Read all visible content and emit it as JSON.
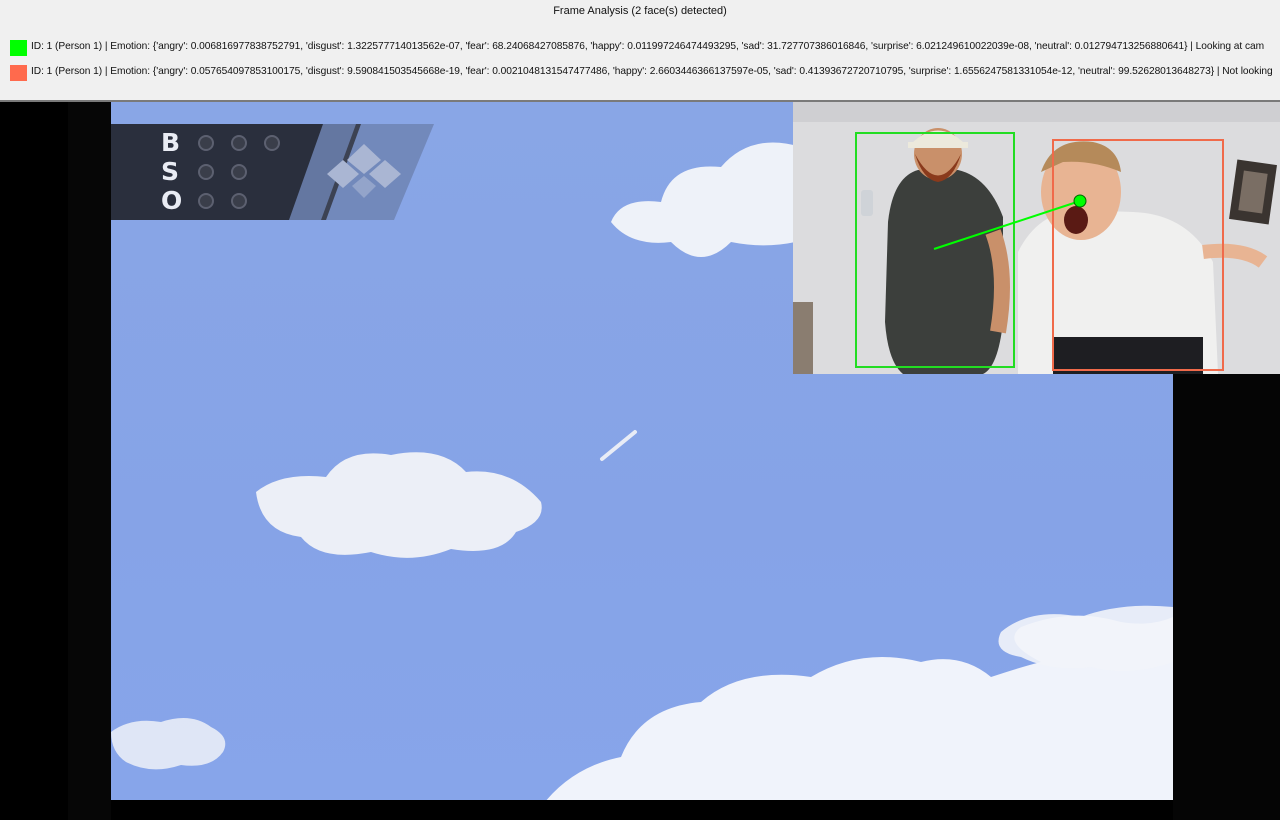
{
  "header": {
    "title": "Frame Analysis (2 face(s) detected)",
    "faces": [
      {
        "color": "#00ff00",
        "text": "ID: 1 (Person 1) | Emotion: {'angry': 0.006816977838752791, 'disgust': 1.322577714013562e-07, 'fear': 68.24068427085876, 'happy': 0.011997246474493295, 'sad': 31.727707386016846, 'surprise': 6.021249610022039e-08, 'neutral': 0.012794713256880641} | Looking at cam"
      },
      {
        "color": "#ff6a4d",
        "text": "ID: 1 (Person 1) | Emotion: {'angry': 0.057654097853100175, 'disgust': 9.590841503545668e-19, 'fear': 0.0021048131547477486, 'happy': 2.6603446366137597e-05, 'sad': 0.41393672720710795, 'surprise': 1.6556247581331054e-12, 'neutral': 99.52628013648273} | Not looking"
      }
    ]
  },
  "scoreboard": {
    "letters": [
      "B",
      "S",
      "O"
    ],
    "dots": [
      3,
      2,
      2
    ],
    "icon": "baseball-diamond-icon"
  },
  "webcam": {
    "box_colors": [
      "#22dd22",
      "#f06a4a"
    ],
    "gaze_color": "#00ff00"
  }
}
